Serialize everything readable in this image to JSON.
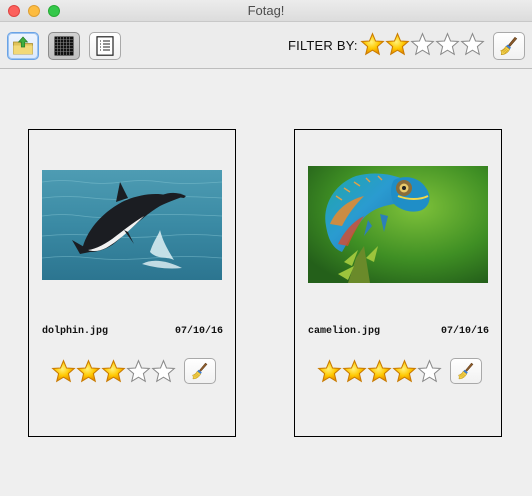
{
  "window": {
    "title": "Fotag!"
  },
  "toolbar": {
    "upload_icon": "upload-folder-icon",
    "grid_view_icon": "grid-view-icon",
    "list_view_icon": "list-view-icon",
    "filter_label": "FILTER BY:",
    "filter_rating": 2,
    "filter_max": 5,
    "clear_filter_icon": "broom-icon"
  },
  "photos": [
    {
      "filename": "dolphin.jpg",
      "date": "07/10/16",
      "rating": 3,
      "max_rating": 5
    },
    {
      "filename": "camelion.jpg",
      "date": "07/10/16",
      "rating": 4,
      "max_rating": 5
    }
  ],
  "colors": {
    "star_fill": "#f7b500",
    "star_empty": "#ffffff",
    "accent": "#6aa3e6"
  }
}
